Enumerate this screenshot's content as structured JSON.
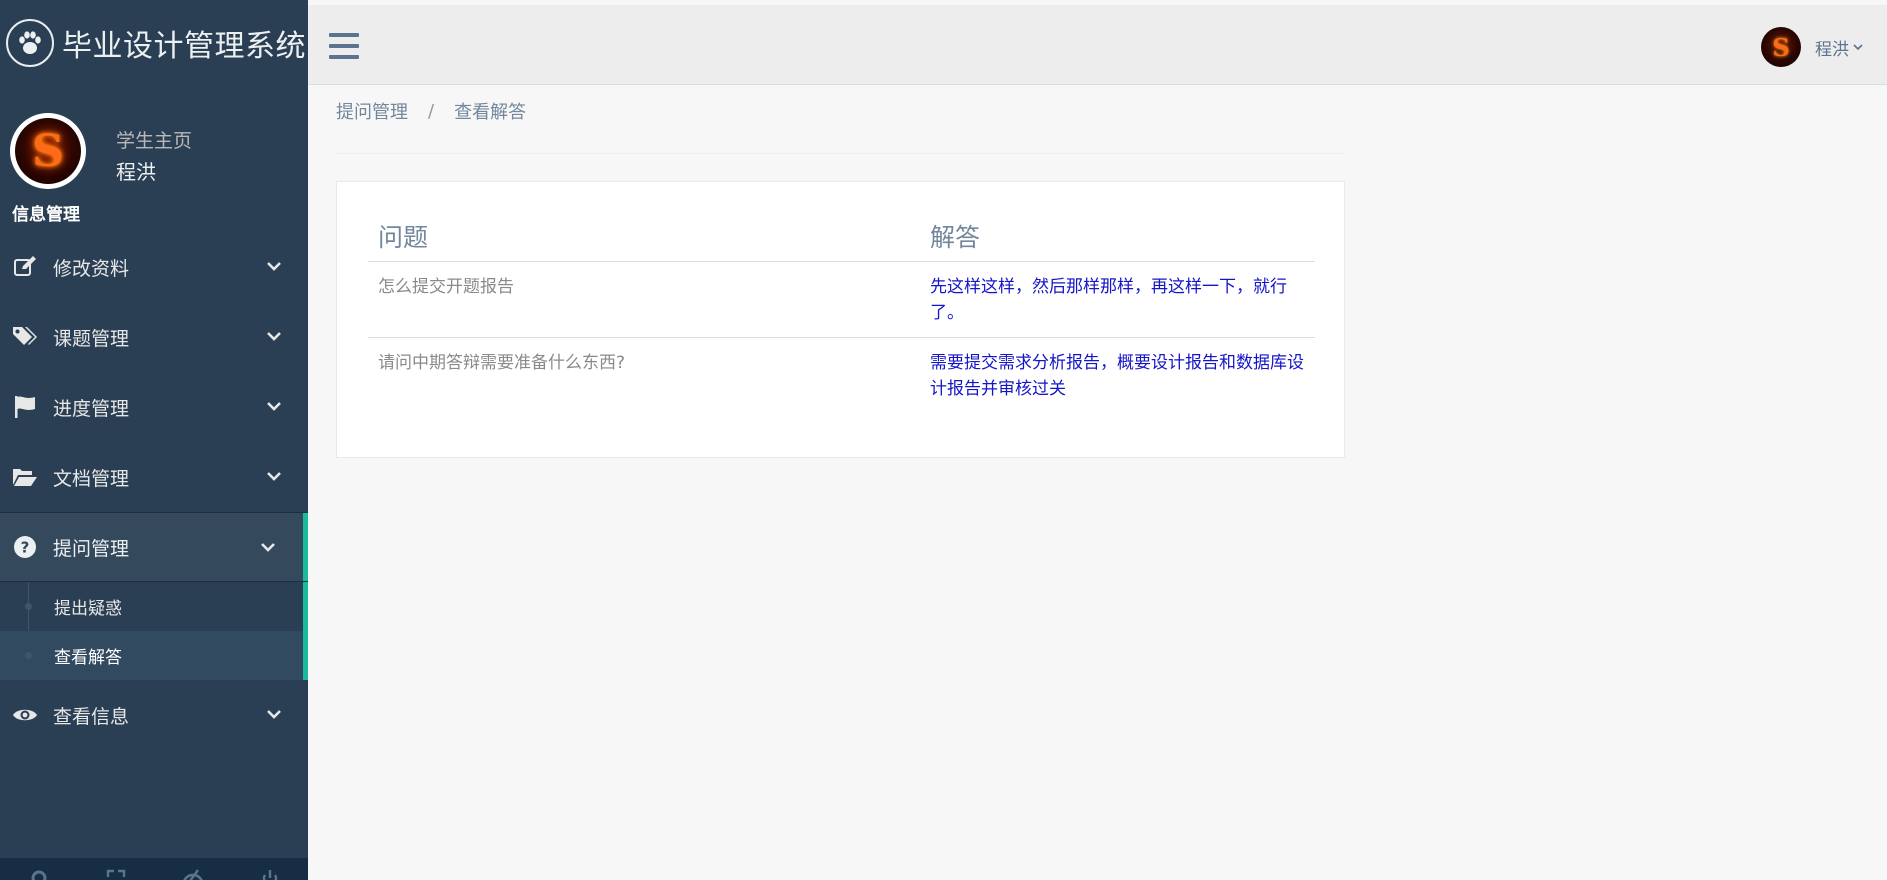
{
  "app": {
    "title": "毕业设计管理系统",
    "logo_icon": "paw-icon"
  },
  "profile": {
    "welcome": "学生主页",
    "name": "程洪",
    "avatar_letter": "S"
  },
  "menu": {
    "section_title": "信息管理",
    "items": [
      {
        "label": "修改资料",
        "icon": "edit-icon"
      },
      {
        "label": "课题管理",
        "icon": "tags-icon"
      },
      {
        "label": "进度管理",
        "icon": "flag-icon"
      },
      {
        "label": "文档管理",
        "icon": "folder-open-icon"
      },
      {
        "label": "提问管理",
        "icon": "question-circle-icon",
        "active": true
      },
      {
        "label": "查看信息",
        "icon": "eye-icon"
      }
    ],
    "submenu": [
      {
        "label": "提出疑惑"
      },
      {
        "label": "查看解答",
        "current": true
      }
    ]
  },
  "topnav": {
    "user_name": "程洪",
    "avatar_letter": "S"
  },
  "breadcrumb": {
    "parent": "提问管理",
    "separator": "/",
    "current": "查看解答"
  },
  "qa_table": {
    "headers": [
      "问题",
      "解答"
    ],
    "rows": [
      {
        "question": "怎么提交开题报告",
        "answer": "先这样这样，然后那样那样，再这样一下，就行了。"
      },
      {
        "question": "请问中期答辩需要准备什么东西?",
        "answer": "需要提交需求分析报告，概要设计报告和数据库设计报告并审核过关"
      }
    ]
  },
  "colors": {
    "sidebar_bg": "#2a3f54",
    "accent": "#1abb9c",
    "answer_text": "#1515c8"
  }
}
